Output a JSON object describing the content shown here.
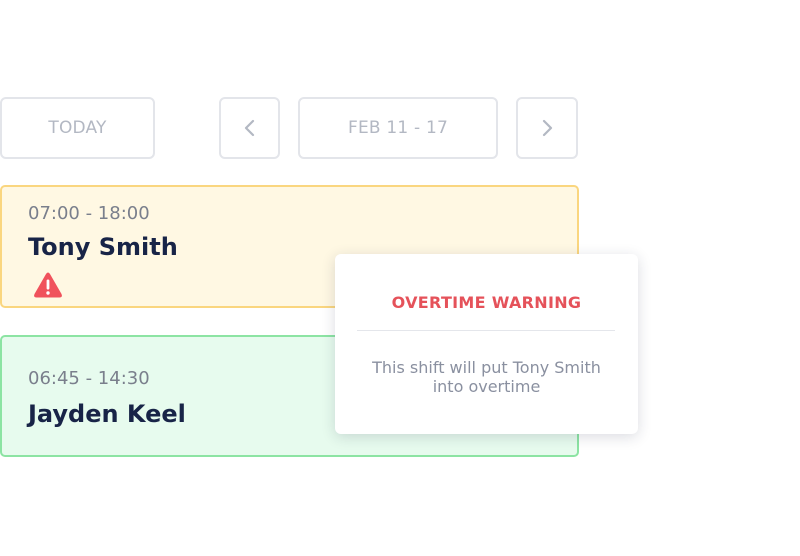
{
  "toolbar": {
    "today_label": "TODAY",
    "prev_icon": "chevron-left-icon",
    "date_range": "FEB 11 - 17",
    "next_icon": "chevron-right-icon"
  },
  "shifts": [
    {
      "time": "07:00 - 18:00",
      "name": "Tony Smith",
      "status_icon": "warning-icon",
      "status_color": "#f0525c",
      "background": "#fff8e3",
      "border": "#fad67f"
    },
    {
      "time": "06:45 - 14:30",
      "name": "Jayden Keel",
      "background": "#e7fbee",
      "border": "#8ce4a3"
    }
  ],
  "tooltip": {
    "title": "OVERTIME WARNING",
    "title_color": "#e5525a",
    "message": "This shift will put Tony Smith into overtime"
  }
}
